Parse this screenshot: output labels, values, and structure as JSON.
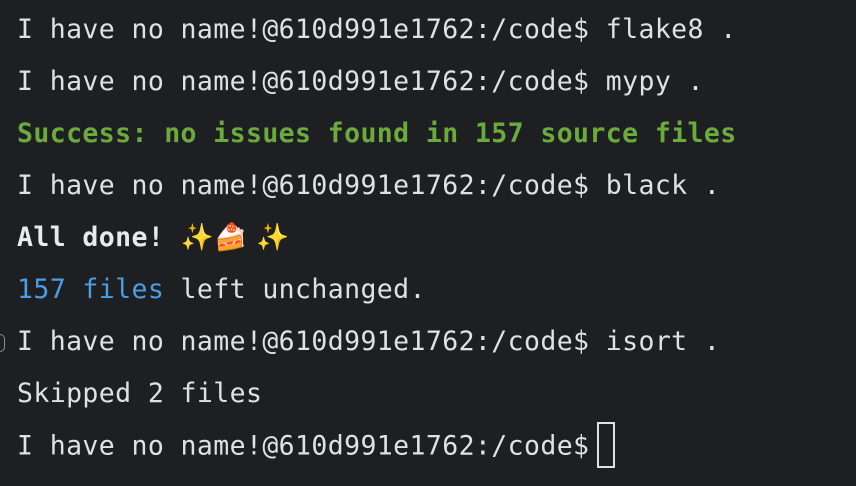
{
  "terminal": {
    "lines": [
      {
        "prompt": "I have no name!@610d991e1762:/code$",
        "command": " flake8 ."
      },
      {
        "prompt": "I have no name!@610d991e1762:/code$",
        "command": " mypy ."
      },
      {
        "output": "Success: no issues found in 157 source files"
      },
      {
        "prompt": "I have no name!@610d991e1762:/code$",
        "command": " black ."
      },
      {
        "output": "All done! ",
        "emoji": "✨🍰 ✨"
      },
      {
        "highlight": "157 files",
        "rest": " left unchanged."
      },
      {
        "prompt": "I have no name!@610d991e1762:/code$",
        "command": " isort ."
      },
      {
        "output": "Skipped 2 files"
      },
      {
        "prompt": "I have no name!@610d991e1762:/code$"
      }
    ]
  },
  "colors": {
    "background": "#1e1f22",
    "text": "#dfe1e5",
    "success": "#6aab3c",
    "link_blue": "#4a9ee6"
  }
}
